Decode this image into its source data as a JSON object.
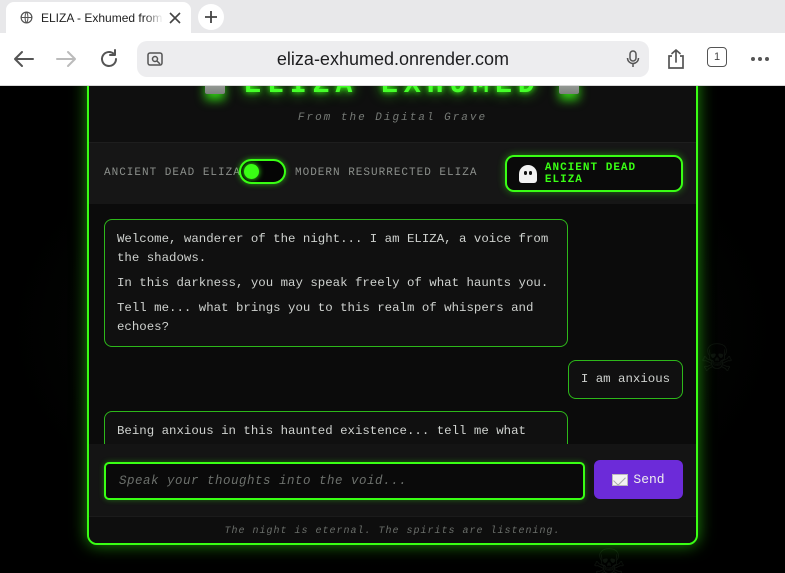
{
  "browser": {
    "tab_title": "ELIZA - Exhumed from the Digital Grave",
    "url": "eliza-exhumed.onrender.com",
    "tab_count": "1"
  },
  "header": {
    "title": "ELIZA EXHUMED",
    "subtitle": "From the Digital Grave"
  },
  "mode": {
    "left_label": "ANCIENT DEAD ELIZA",
    "right_label": "MODERN RESURRECTED ELIZA",
    "button_label": "ANCIENT DEAD ELIZA"
  },
  "messages": [
    {
      "role": "bot",
      "paragraphs": [
        "Welcome, wanderer of the night... I am ELIZA, a voice from the shadows.",
        "In this darkness, you may speak freely of what haunts you.",
        "Tell me... what brings you to this realm of whispers and echoes?"
      ]
    },
    {
      "role": "user",
      "text": "I am anxious"
    },
    {
      "role": "bot",
      "paragraphs": [
        "Being anxious in this haunted existence... tell me what"
      ]
    }
  ],
  "input": {
    "placeholder": "Speak your thoughts into the void..."
  },
  "send": {
    "label": "Send"
  },
  "footer": {
    "text": "The night is eternal. The spirits are listening."
  },
  "colors": {
    "neon": "#39ff14",
    "send": "#6c2bd9",
    "background": "#000000"
  }
}
